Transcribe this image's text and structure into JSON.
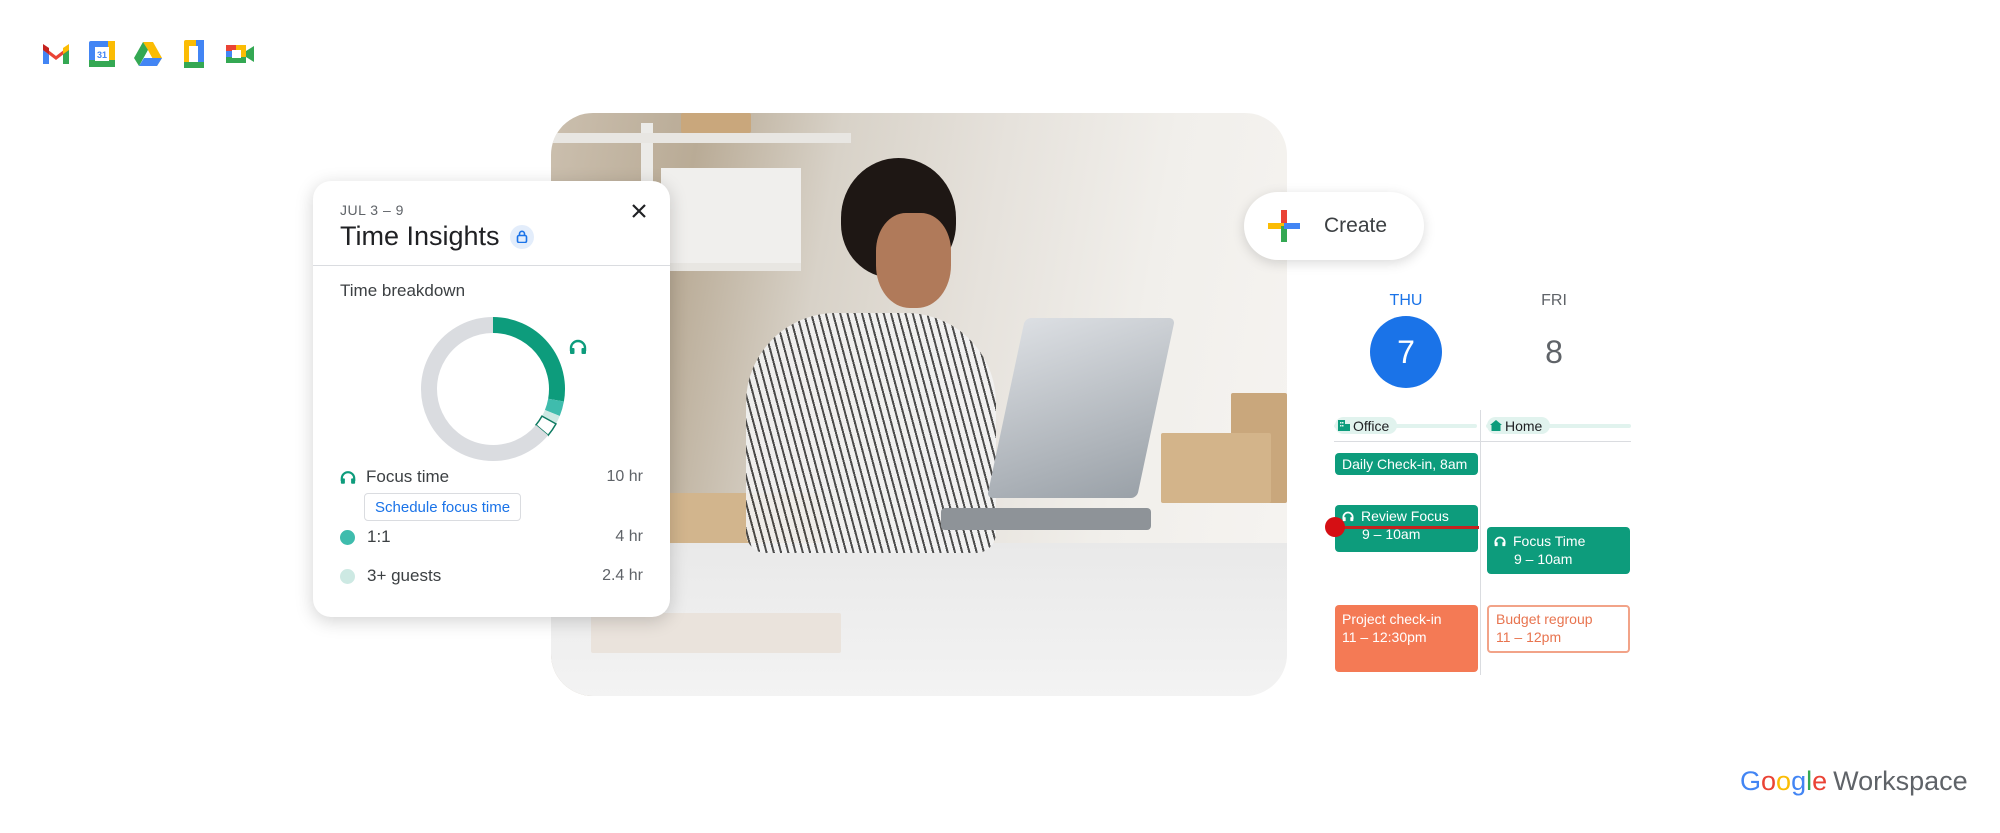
{
  "app_icons": [
    {
      "name": "gmail",
      "label": "Gmail"
    },
    {
      "name": "calendar",
      "label": "Calendar",
      "badge": "31"
    },
    {
      "name": "drive",
      "label": "Drive"
    },
    {
      "name": "docs",
      "label": "Docs"
    },
    {
      "name": "meet",
      "label": "Meet"
    }
  ],
  "time_insights": {
    "date_range": "JUL 3 – 9",
    "title": "Time Insights",
    "section_title": "Time breakdown",
    "close_icon": "close-icon",
    "lock_icon": "lock-icon",
    "schedule_button": "Schedule focus time",
    "categories": [
      {
        "label": "Focus time",
        "value": "10 hr",
        "hours": 10,
        "icon": "headphones-icon",
        "color": "#0d9c7c"
      },
      {
        "label": "1:1",
        "value": "4 hr",
        "hours": 4,
        "color": "#3fbcad"
      },
      {
        "label": "3+ guests",
        "value": "2.4 hr",
        "hours": 2.4,
        "color": "#cde9e3"
      }
    ],
    "chart_data": {
      "type": "pie",
      "variant": "donut",
      "title": "Time breakdown",
      "slices": [
        {
          "label": "Focus time",
          "value": 10,
          "color": "#0d9c7c"
        },
        {
          "label": "1:1",
          "value": 1.2,
          "color": "#3fbcad"
        },
        {
          "label": "3+ guests",
          "value": 0.7,
          "color": "#cde9e3"
        },
        {
          "label": "Other (outlined)",
          "value": 1.1,
          "color": "#ffffff"
        },
        {
          "label": "Remaining",
          "value": 23,
          "color": "#dadce0"
        }
      ]
    }
  },
  "create_button": {
    "label": "Create",
    "icon": "plus-icon"
  },
  "calendar": {
    "days": [
      {
        "name": "THU",
        "number": "7",
        "today": true
      },
      {
        "name": "FRI",
        "number": "8",
        "today": false
      }
    ],
    "locations": [
      {
        "label": "Office",
        "icon": "building-icon"
      },
      {
        "label": "Home",
        "icon": "home-icon"
      }
    ],
    "events": {
      "daily_checkin": {
        "title": "Daily Check-in, 8am"
      },
      "review_focus": {
        "title": "Review Focus",
        "time": "9 – 10am"
      },
      "focus_time": {
        "title": "Focus Time",
        "time": "9 – 10am"
      },
      "project_checkin": {
        "title": "Project check-in",
        "time": "11 – 12:30pm"
      },
      "budget_regroup": {
        "title": "Budget regroup",
        "time": "11 – 12pm"
      }
    },
    "colors": {
      "today": "#1a73e8",
      "event_green": "#0d9c7c",
      "event_orange": "#f47a55",
      "now_line": "#c5221f"
    }
  },
  "brand": {
    "google_letters": [
      {
        "ch": "G",
        "color": "#4285f4"
      },
      {
        "ch": "o",
        "color": "#ea4335"
      },
      {
        "ch": "o",
        "color": "#fbbc04"
      },
      {
        "ch": "g",
        "color": "#4285f4"
      },
      {
        "ch": "l",
        "color": "#34a853"
      },
      {
        "ch": "e",
        "color": "#ea4335"
      }
    ],
    "product": "Workspace"
  }
}
